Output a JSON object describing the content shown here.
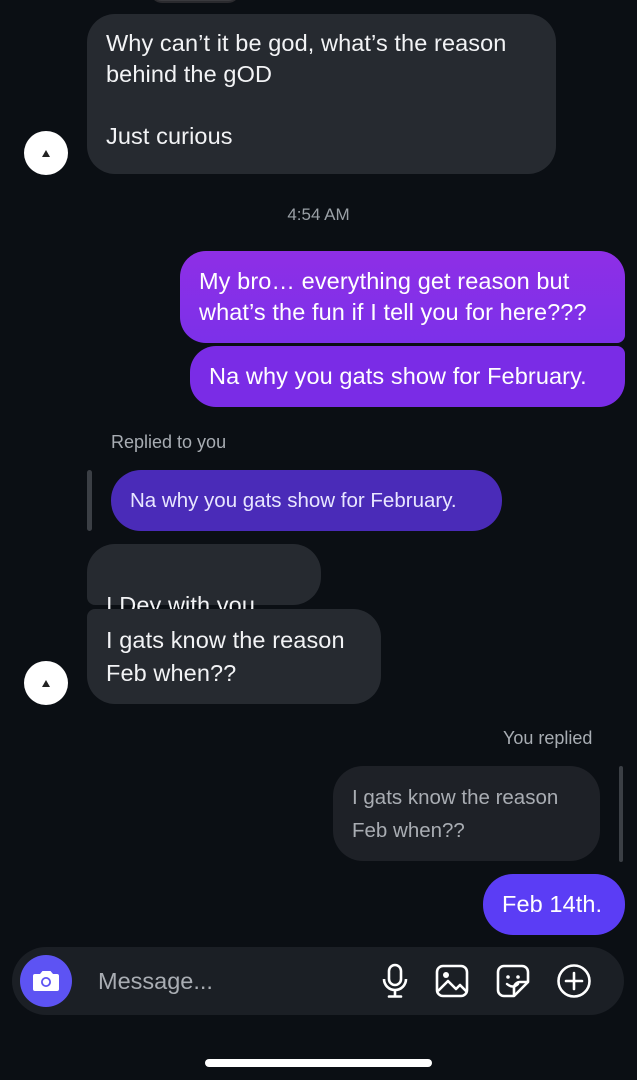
{
  "thread": {
    "msg1": "Why can’t it be god, what’s the reason\nbehind the gOD\n\nJust curious",
    "timestamp": "4:54 AM",
    "out1": "My bro… everything get reason but\nwhat’s the fun if I tell you for here???",
    "out2": "Na why you gats show for February.",
    "replied_label": "Replied to you",
    "quoted_in": "Na why you gats show for February.",
    "msg2_text": "I Dey with you",
    "msg2_emoji": "🔐",
    "msg3": "I gats know the reason\nFeb when??",
    "you_replied_label": "You replied",
    "quoted_out": "I gats know the reason\nFeb when??",
    "out3": "Feb 14th."
  },
  "composer": {
    "placeholder": "Message..."
  },
  "colors": {
    "background": "#0b0f14",
    "incoming_bubble": "#262a30",
    "outgoing_bubble": "#7c30e9",
    "reply_bubble": "#5b3df5",
    "camera_button": "#5d53f3"
  },
  "icons": {
    "camera": "camera-icon",
    "mic": "microphone-icon",
    "gallery": "image-icon",
    "sticker": "sticker-icon",
    "add": "plus-circle-icon"
  }
}
